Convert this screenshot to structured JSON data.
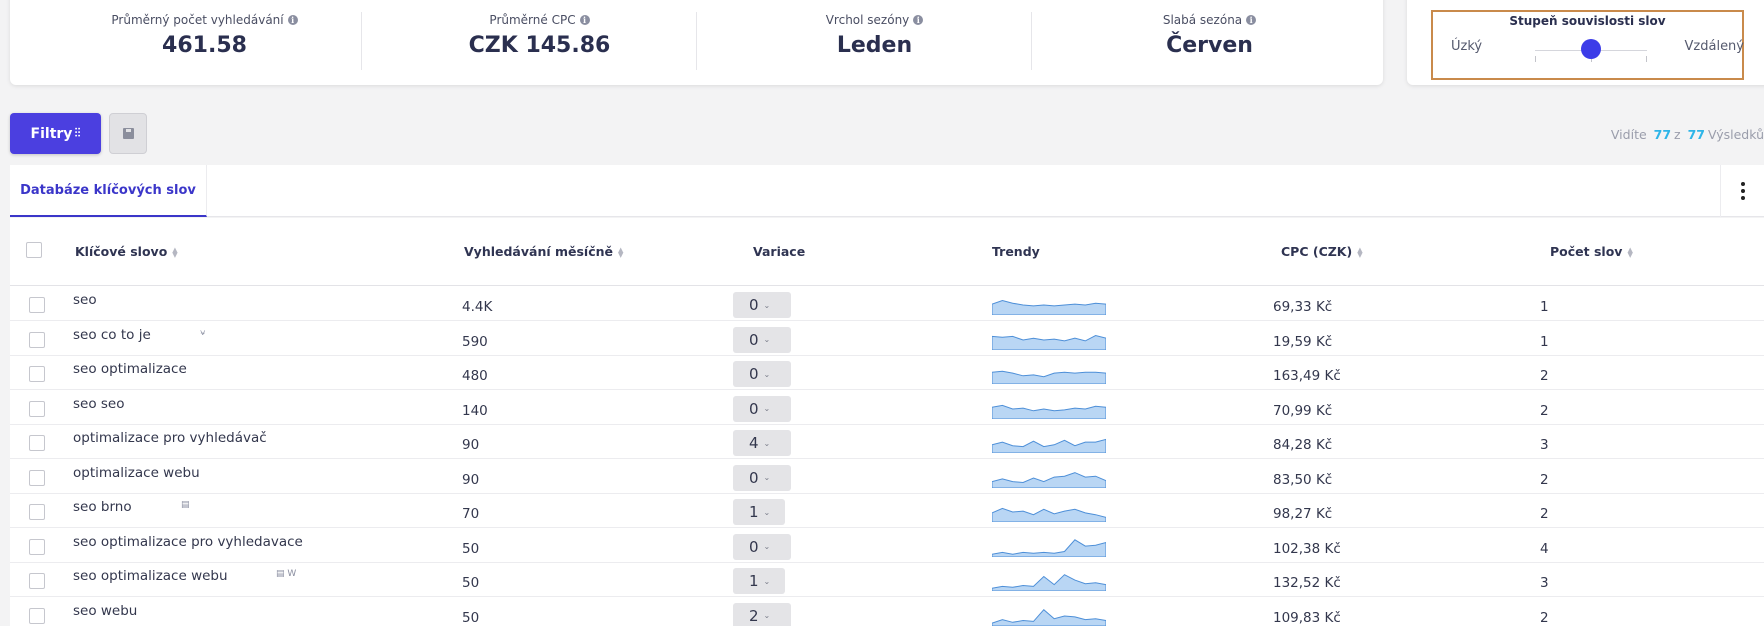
{
  "stats": [
    {
      "label": "Průměrný počet vyhledávání",
      "value": "461.58"
    },
    {
      "label": "Průměrné CPC",
      "value": "CZK 145.86"
    },
    {
      "label": "Vrchol sezóny",
      "value": "Leden"
    },
    {
      "label": "Slabá sezóna",
      "value": "Červen"
    }
  ],
  "relatedness": {
    "title": "Stupeň souvislosti slov",
    "left": "Úzký",
    "right": "Vzdálený",
    "level": 0.5
  },
  "toolbar": {
    "filter_label": "Filtry"
  },
  "results": {
    "prefix": "Vidíte",
    "shown": "77",
    "sep": "z",
    "total": "77",
    "suffix": "Výsledků"
  },
  "tabs": [
    {
      "label": "Databáze klíčových slov"
    }
  ],
  "columns": {
    "keyword": "Klíčové slovo",
    "volume": "Vyhledávání měsíčně",
    "variation": "Variace",
    "trends": "Trendy",
    "cpc": "CPC (CZK)",
    "words": "Počet slov"
  },
  "rows": [
    {
      "keyword": "seo",
      "icon": "",
      "volume": "4.4K",
      "variation": "0",
      "cpc": "69,33 Kč",
      "words": "1",
      "trend": [
        0.55,
        0.75,
        0.6,
        0.5,
        0.45,
        0.5,
        0.45,
        0.5,
        0.55,
        0.5,
        0.6,
        0.55
      ]
    },
    {
      "keyword": "seo co to je",
      "icon": "⍱",
      "volume": "590",
      "variation": "0",
      "cpc": "19,59 Kč",
      "words": "1",
      "trend": [
        0.7,
        0.65,
        0.7,
        0.5,
        0.6,
        0.5,
        0.55,
        0.45,
        0.6,
        0.45,
        0.75,
        0.6
      ]
    },
    {
      "keyword": "seo optimalizace",
      "icon": "",
      "volume": "480",
      "variation": "0",
      "cpc": "163,49 Kč",
      "words": "2",
      "trend": [
        0.6,
        0.65,
        0.55,
        0.4,
        0.45,
        0.35,
        0.55,
        0.6,
        0.55,
        0.6,
        0.6,
        0.55
      ]
    },
    {
      "keyword": "seo seo",
      "icon": "",
      "volume": "140",
      "variation": "0",
      "cpc": "70,99 Kč",
      "words": "2",
      "trend": [
        0.6,
        0.7,
        0.5,
        0.55,
        0.4,
        0.5,
        0.4,
        0.45,
        0.55,
        0.5,
        0.65,
        0.6
      ]
    },
    {
      "keyword": "optimalizace pro vyhledávač",
      "icon": "",
      "volume": "90",
      "variation": "4",
      "cpc": "84,28 Kč",
      "words": "3",
      "trend": [
        0.4,
        0.55,
        0.35,
        0.3,
        0.6,
        0.3,
        0.4,
        0.65,
        0.35,
        0.55,
        0.55,
        0.7
      ]
    },
    {
      "keyword": "optimalizace webu",
      "icon": "",
      "volume": "90",
      "variation": "0",
      "cpc": "83,50 Kč",
      "words": "2",
      "trend": [
        0.3,
        0.45,
        0.3,
        0.25,
        0.5,
        0.3,
        0.55,
        0.6,
        0.8,
        0.55,
        0.6,
        0.35
      ]
    },
    {
      "keyword": "seo brno",
      "icon": "▤",
      "volume": "70",
      "variation": "1",
      "cpc": "98,27 Kč",
      "words": "2",
      "trend": [
        0.45,
        0.7,
        0.5,
        0.55,
        0.35,
        0.65,
        0.4,
        0.55,
        0.65,
        0.45,
        0.35,
        0.2
      ]
    },
    {
      "keyword": "seo optimalizace pro vyhledavace",
      "icon": "",
      "volume": "50",
      "variation": "0",
      "cpc": "102,38 Kč",
      "words": "4",
      "trend": [
        0.1,
        0.2,
        0.1,
        0.2,
        0.15,
        0.2,
        0.15,
        0.25,
        0.9,
        0.55,
        0.6,
        0.75
      ]
    },
    {
      "keyword": "seo optimalizace webu",
      "icon": "▤ W",
      "volume": "50",
      "variation": "1",
      "cpc": "132,52 Kč",
      "words": "3",
      "trend": [
        0.1,
        0.2,
        0.15,
        0.25,
        0.2,
        0.75,
        0.3,
        0.85,
        0.55,
        0.35,
        0.4,
        0.3
      ]
    },
    {
      "keyword": "seo webu",
      "icon": "",
      "volume": "50",
      "variation": "2",
      "cpc": "109,83 Kč",
      "words": "2",
      "trend": [
        0.1,
        0.3,
        0.15,
        0.25,
        0.2,
        0.85,
        0.35,
        0.5,
        0.45,
        0.3,
        0.35,
        0.25
      ]
    }
  ]
}
